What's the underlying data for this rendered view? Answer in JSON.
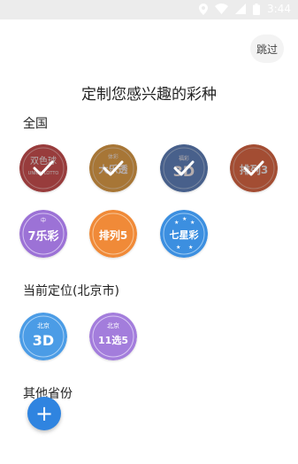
{
  "status_bar": {
    "time": "3:44"
  },
  "header": {
    "skip_label": "跳过",
    "title": "定制您感兴趣的彩种"
  },
  "sections": {
    "national": {
      "label": "全国",
      "items": [
        {
          "name": "双色球",
          "sub": "UNION LOTTO",
          "selected": true
        },
        {
          "name": "大乐透",
          "sub": "体彩",
          "selected": true
        },
        {
          "name": "3D",
          "sub": "福彩",
          "selected": true
        },
        {
          "name": "排列3",
          "sub": "",
          "selected": true
        },
        {
          "name": "7乐彩",
          "sub": "中",
          "selected": false
        },
        {
          "name": "排列5",
          "sub": "",
          "selected": false
        },
        {
          "name": "七星彩",
          "sub": "",
          "selected": false
        }
      ]
    },
    "current_location": {
      "label": "当前定位(北京市)",
      "items": [
        {
          "name": "3D",
          "sub": "北京",
          "selected": false
        },
        {
          "name": "11选5",
          "sub": "北京",
          "selected": false
        }
      ]
    },
    "other_provinces": {
      "label": "其他省份",
      "add_label": "+"
    }
  },
  "colors": {
    "accent": "#2f84e0",
    "status_bar": "#ececec"
  }
}
